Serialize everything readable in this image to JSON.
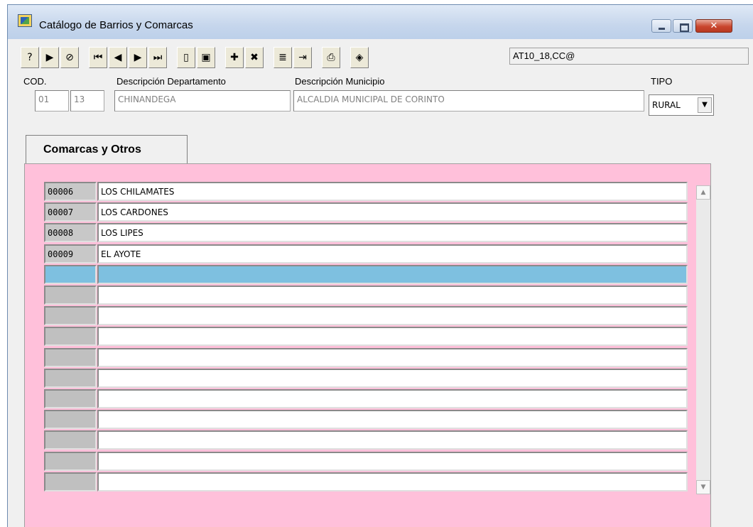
{
  "window": {
    "title": "Catálogo de Barrios y Comarcas",
    "close_glyph": "✕",
    "icon": "catalog-app-icon"
  },
  "toolbar": {
    "user_field": "AT10_18,CC@",
    "buttons": [
      {
        "name": "query-icon",
        "glyph": "?"
      },
      {
        "name": "execute-query-icon",
        "glyph": "▶"
      },
      {
        "name": "cancel-query-icon",
        "glyph": "⊘"
      },
      {
        "name": "first-record-icon",
        "glyph": "⏮"
      },
      {
        "name": "prev-record-icon",
        "glyph": "◀"
      },
      {
        "name": "next-record-icon",
        "glyph": "▶"
      },
      {
        "name": "last-record-icon",
        "glyph": "⏭"
      },
      {
        "name": "new-document-icon",
        "glyph": "▯"
      },
      {
        "name": "save-icon",
        "glyph": "▣"
      },
      {
        "name": "add-record-icon",
        "glyph": "✚"
      },
      {
        "name": "delete-record-icon",
        "glyph": "✖"
      },
      {
        "name": "list-icon",
        "glyph": "≣"
      },
      {
        "name": "exit-icon",
        "glyph": "⇥"
      },
      {
        "name": "print-icon",
        "glyph": "⎙"
      },
      {
        "name": "help-book-icon",
        "glyph": "◈"
      }
    ]
  },
  "header": {
    "labels": {
      "cod": "COD.",
      "departamento": "Descripción Departamento",
      "municipio": "Descripción Municipio",
      "tipo": "TIPO"
    },
    "values": {
      "cod1": "01",
      "cod2": "13",
      "departamento": "CHINANDEGA",
      "municipio": "ALCALDIA MUNICIPAL DE CORINTO",
      "tipo": "RURAL"
    }
  },
  "tab": {
    "label": "Comarcas y Otros"
  },
  "grid": {
    "rows": [
      {
        "code": "00006",
        "desc": "LOS CHILAMATES"
      },
      {
        "code": "00007",
        "desc": "LOS CARDONES"
      },
      {
        "code": "00008",
        "desc": "LOS LIPES"
      },
      {
        "code": "00009",
        "desc": "EL AYOTE"
      },
      {
        "code": "",
        "desc": "",
        "selected": true
      },
      {
        "code": "",
        "desc": ""
      },
      {
        "code": "",
        "desc": ""
      },
      {
        "code": "",
        "desc": ""
      },
      {
        "code": "",
        "desc": ""
      },
      {
        "code": "",
        "desc": ""
      },
      {
        "code": "",
        "desc": ""
      },
      {
        "code": "",
        "desc": ""
      },
      {
        "code": "",
        "desc": ""
      },
      {
        "code": "",
        "desc": ""
      },
      {
        "code": "",
        "desc": ""
      }
    ]
  },
  "colors": {
    "panel_bg": "#ffc0da",
    "selected_row": "#7ec0e0"
  }
}
